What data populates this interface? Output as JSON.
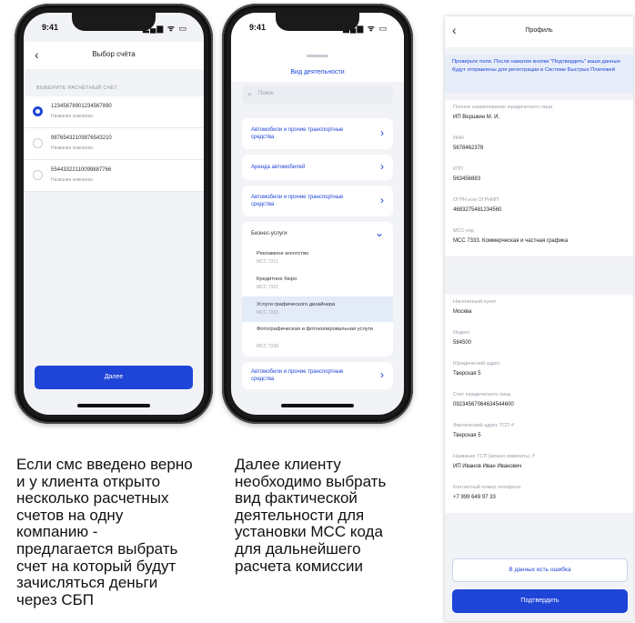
{
  "phone1": {
    "status_time": "9:41",
    "status_indicators": "▂▄▆ ᯤ ▭",
    "back_icon": "chevron-left",
    "title": "Выбор счёта",
    "section_label": "ВЫБЕРИТЕ РАСЧЁТНЫЙ СЧЁТ",
    "accounts": [
      {
        "number": "12345678901234567890",
        "label": "Название компании",
        "selected": true
      },
      {
        "number": "98765432109876543210",
        "label": "Название компании",
        "selected": false
      },
      {
        "number": "55443322110099887766",
        "label": "Название компании",
        "selected": false
      }
    ],
    "next_button": "Далее"
  },
  "phone2": {
    "status_time": "9:41",
    "status_indicators": "▂▄▆ ᯤ ▭",
    "title": "Вид деятельности",
    "search_placeholder": "Поиск",
    "categories": [
      {
        "label": "Автомобили и прочие транспортные средства",
        "chevron": "›"
      },
      {
        "label": "Аренда автомобилей",
        "chevron": "›"
      },
      {
        "label": "Автомобили и прочие транспортные средства",
        "chevron": "›"
      },
      {
        "label": "Бизнес-услуги",
        "chevron": "⌄"
      }
    ],
    "subitems": [
      {
        "title": "Рекламное агентство",
        "mcc": "MCC 7311"
      },
      {
        "title": "Кредитное бюро",
        "mcc": "MCC 7321"
      },
      {
        "title": "Услуги графического дизайнера",
        "mcc": "MCC 7333"
      },
      {
        "title": "Фотографическая и фотокопировальная услуги",
        "mcc": "MCC 7338"
      }
    ],
    "bottom_category": {
      "label": "Автомобили и прочие транспортные средства",
      "chevron": "›"
    }
  },
  "phone3": {
    "back_icon": "chevron-left",
    "title": "Профиль",
    "notice": "Проверьте поля. После нажатия кнопки \"Подтвердить\" ваши данные будут отправлены для регистрации в Системе Быстрых Платежей",
    "fields_top": [
      {
        "label": "Полное наименование юридического лица",
        "value": "ИП Вершкин М. И."
      },
      {
        "label": "ИНН",
        "value": "5678462378"
      },
      {
        "label": "КПП",
        "value": "563456883"
      },
      {
        "label": "ОГРН или ОГРНИП",
        "value": "4683275481234560"
      },
      {
        "label": "МСС-код",
        "value": "MCC 7333. Коммерческая и частная графика"
      }
    ],
    "fields_bottom": [
      {
        "label": "Населенный пункт",
        "value": "Москва"
      },
      {
        "label": "Индекс",
        "value": "584500"
      },
      {
        "label": "Юридический адрес",
        "value": "Тверская 5"
      },
      {
        "label": "Счет юридического лица",
        "value": "09234567064634544600"
      },
      {
        "label": "Фактический адрес ТСП ✐",
        "value": "Тверская 5"
      },
      {
        "label": "Название ТСП (можно изменить) ✐",
        "value": "ИП Иванов Иван Иванович"
      },
      {
        "label": "Контактный номер телефона",
        "value": "+7 999 649 97 33"
      }
    ],
    "report_error_button": "В данных есть ошибка",
    "confirm_button": "Подтвердить"
  },
  "captions": {
    "left": [
      "Если смс введено верно",
      "и у клиента открыто",
      "несколько расчетных",
      "счетов на одну",
      "компанию -",
      "предлагается выбрать",
      "счет на который будут",
      "зачисляться деньги",
      "через СБП"
    ],
    "middle": [
      "Далее клиенту",
      "необходимо выбрать",
      "вид фактической",
      "деятельности для",
      "установки МСС кода",
      "для дальнейшего",
      "расчета комиссии"
    ]
  },
  "colors": {
    "accent": "#1f45d8",
    "background": "#f2f3f7",
    "selected_row": "#e3ebf8"
  }
}
